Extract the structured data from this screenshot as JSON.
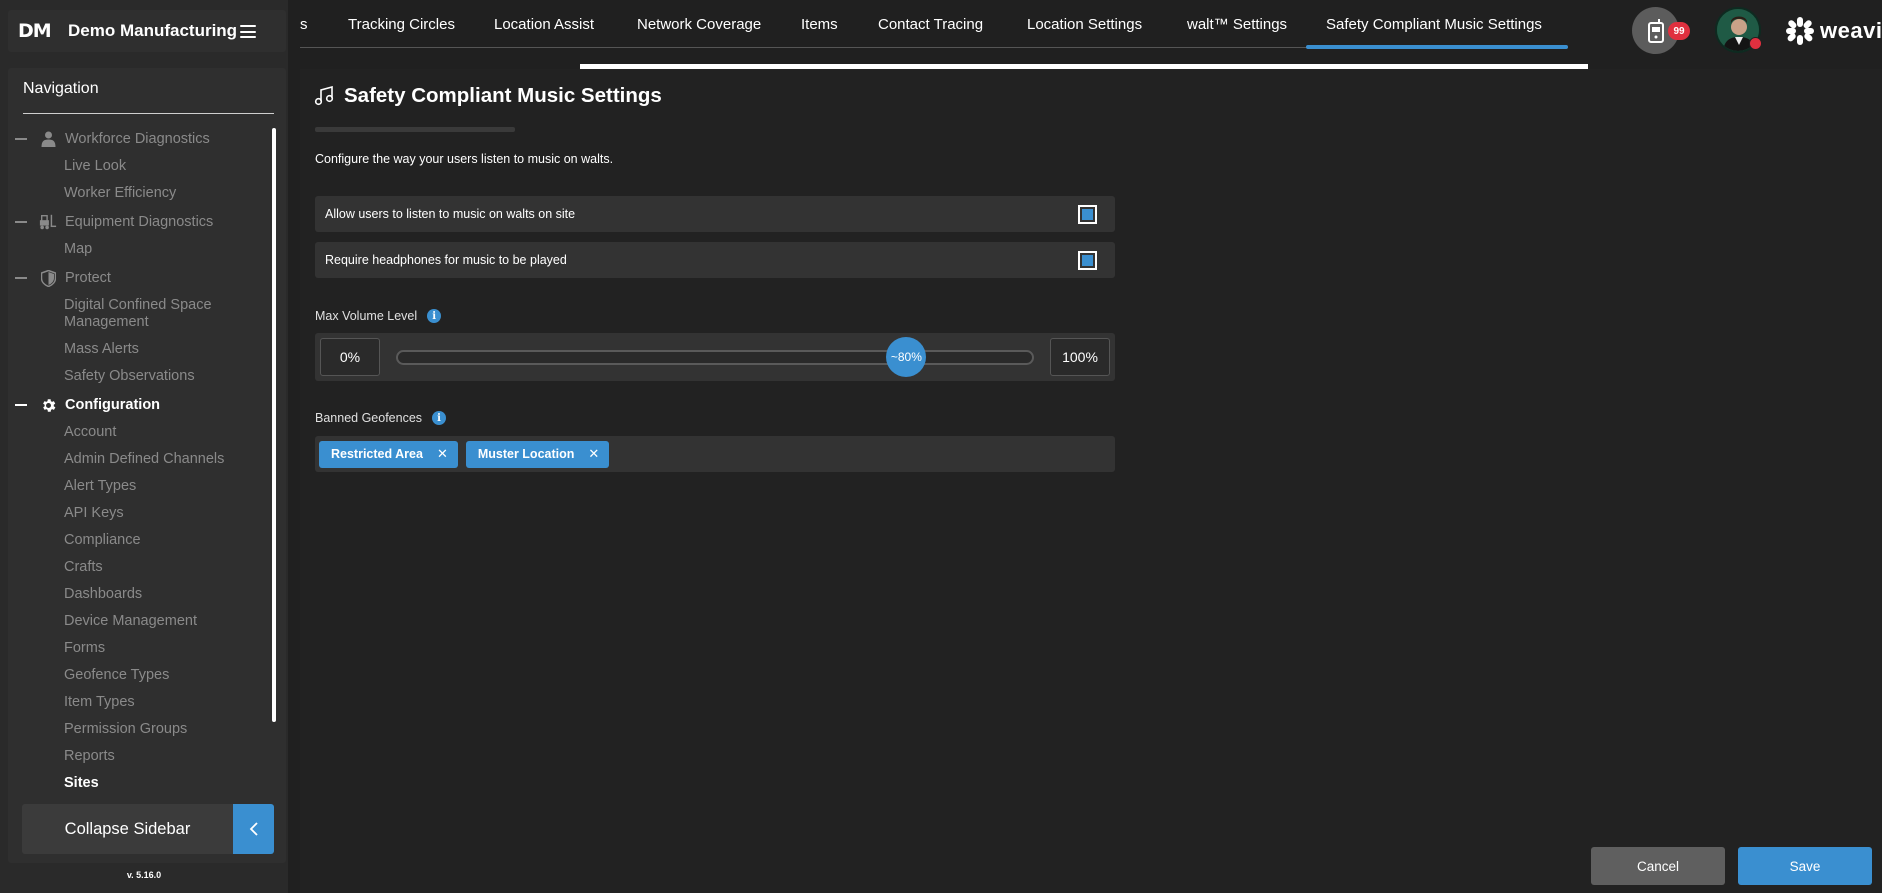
{
  "brand": {
    "logo": "DM",
    "name": "Demo Manufacturing"
  },
  "navigation": {
    "title": "Navigation",
    "sections": [
      {
        "label": "Workforce Diagnostics",
        "icon": "person-icon",
        "items": [
          "Live Look",
          "Worker Efficiency"
        ]
      },
      {
        "label": "Equipment Diagnostics",
        "icon": "forklift-icon",
        "items": [
          "Map"
        ]
      },
      {
        "label": "Protect",
        "icon": "shield-icon",
        "items": [
          "Digital Confined Space",
          "Management",
          "Mass Alerts",
          "Safety Observations"
        ]
      },
      {
        "label": "Configuration",
        "icon": "gear-icon",
        "items": [
          "Account",
          "Admin Defined Channels",
          "Alert Types",
          "API Keys",
          "Compliance",
          "Crafts",
          "Dashboards",
          "Device Management",
          "Forms",
          "Geofence Types",
          "Item Types",
          "Permission Groups",
          "Reports",
          "Sites"
        ]
      }
    ],
    "active_item": "Sites",
    "collapse_label": "Collapse Sidebar",
    "version": "v. 5.16.0"
  },
  "tabs": [
    "s",
    "Tracking Circles",
    "Location Assist",
    "Network Coverage",
    "Items",
    "Contact Tracing",
    "Location Settings",
    "walt™ Settings",
    "Safety Compliant Music Settings"
  ],
  "active_tab": "Safety Compliant Music Settings",
  "header": {
    "device_badge": "99",
    "brand_text": "weavix"
  },
  "page": {
    "title": "Safety Compliant Music Settings",
    "description": "Configure the way your users listen to music on walts.",
    "settings": [
      {
        "label": "Allow users to listen to music on walts on site",
        "checked": true
      },
      {
        "label": "Require headphones for music to be played",
        "checked": true
      }
    ],
    "volume": {
      "label": "Max Volume Level",
      "min_label": "0%",
      "max_label": "100%",
      "value_percent": 80,
      "value_label": "~80%"
    },
    "geofences": {
      "label": "Banned Geofences",
      "tags": [
        "Restricted Area",
        "Muster Location"
      ]
    },
    "actions": {
      "cancel": "Cancel",
      "save": "Save"
    }
  },
  "colors": {
    "accent": "#3a8fd0",
    "badge": "#e0303f",
    "background": "#202020"
  }
}
